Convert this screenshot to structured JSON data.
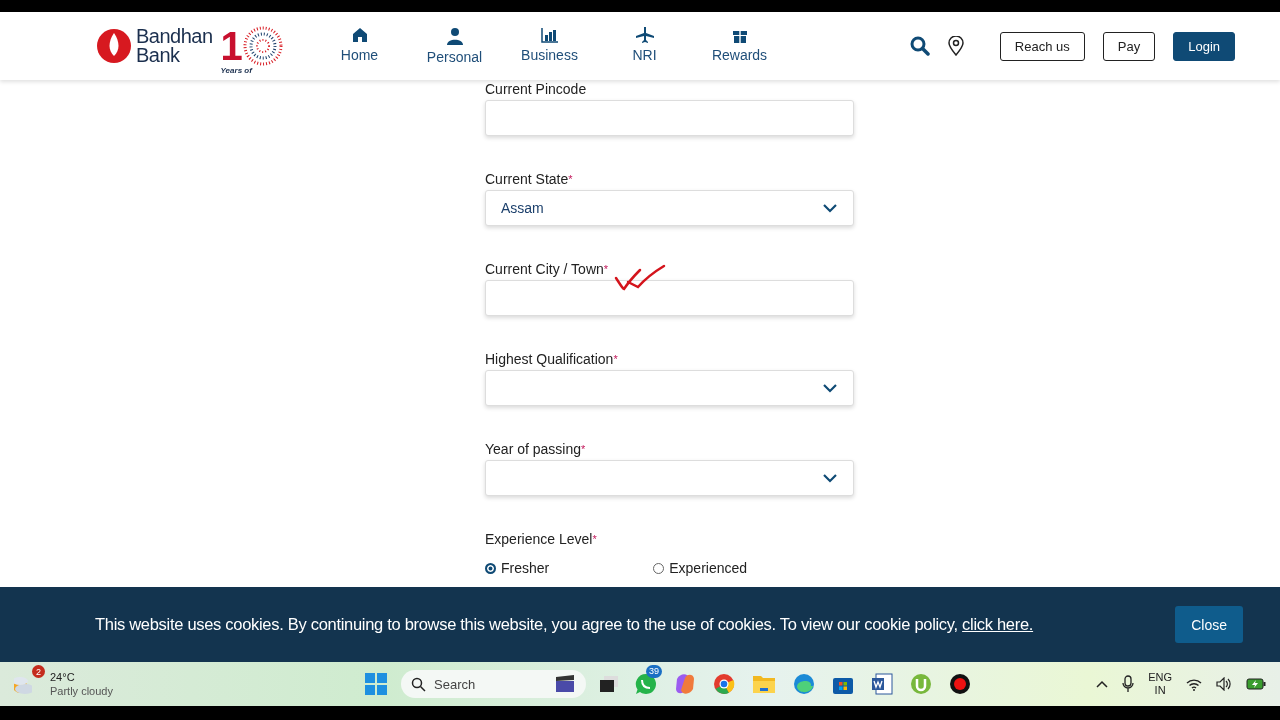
{
  "logo": {
    "name_line_1": "Bandhan",
    "name_line_2": "Bank",
    "anniversary_digit": "1",
    "anniversary_caption": "Years of"
  },
  "nav": [
    {
      "label": "Home"
    },
    {
      "label": "Personal"
    },
    {
      "label": "Business"
    },
    {
      "label": "NRI"
    },
    {
      "label": "Rewards"
    }
  ],
  "header_buttons": [
    {
      "label": "Reach us",
      "kind": "outline"
    },
    {
      "label": "Pay",
      "kind": "outline"
    },
    {
      "label": "Login",
      "kind": "primary"
    }
  ],
  "form": {
    "fields": [
      {
        "label": "Current Pincode",
        "required": false,
        "kind": "text"
      },
      {
        "label": "Current State",
        "required": true,
        "kind": "select",
        "value": "Assam"
      },
      {
        "label": "Current City / Town",
        "required": true,
        "kind": "text"
      },
      {
        "label": "Highest Qualification",
        "required": true,
        "kind": "select"
      },
      {
        "label": "Year of passing",
        "required": true,
        "kind": "select"
      }
    ],
    "experience": {
      "label": "Experience Level",
      "required": true,
      "required_mark": "*",
      "options": [
        {
          "label": "Fresher",
          "selected": true
        },
        {
          "label": "Experienced",
          "selected": false
        }
      ]
    }
  },
  "cookie_banner": {
    "text": "This website uses cookies. By continuing to browse this website, you agree to the use of cookies. To view our cookie policy,",
    "link": "click here.",
    "button": "Close"
  },
  "taskbar": {
    "weather": {
      "badge": "2",
      "temperature": "24°C",
      "condition": "Partly cloudy"
    },
    "search_placeholder": "Search",
    "whatsapp_badge": "39",
    "language": {
      "line_1": "ENG",
      "line_2": "IN"
    }
  }
}
